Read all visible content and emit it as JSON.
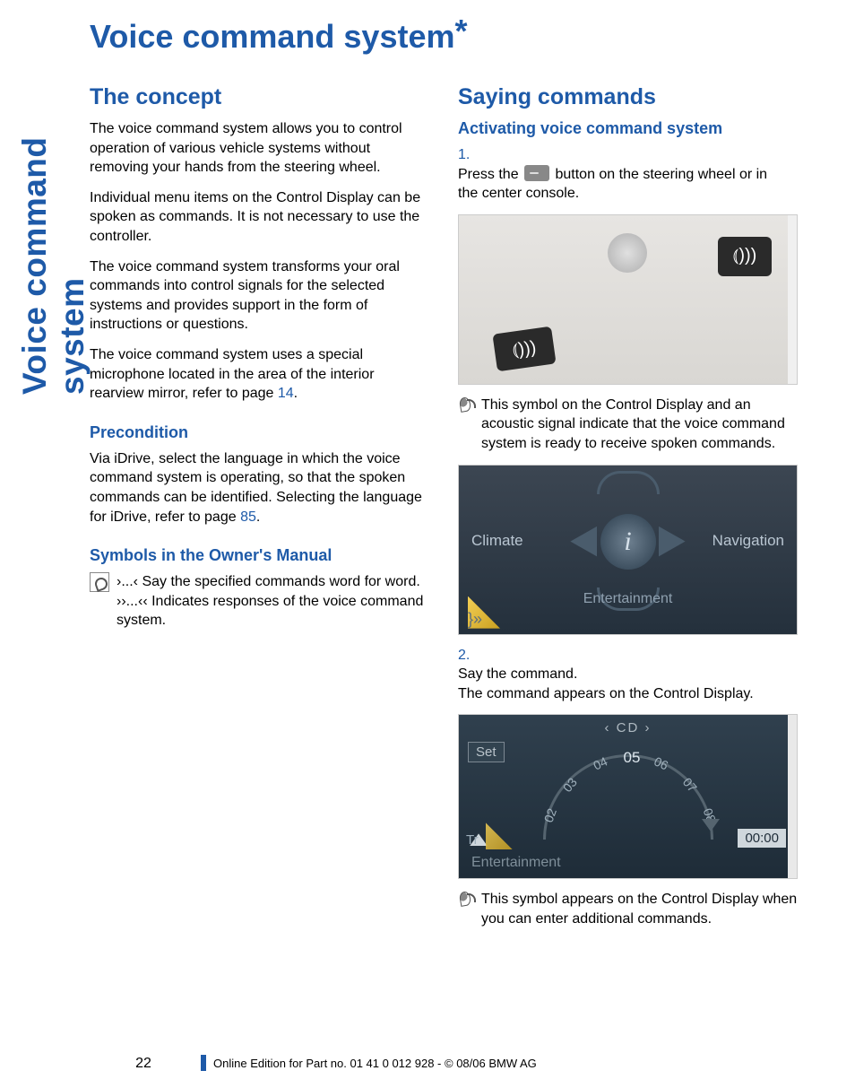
{
  "sidetab": "Voice command system",
  "title": "Voice command system",
  "title_marker": "*",
  "left": {
    "h_concept": "The concept",
    "p1": "The voice command system allows you to control operation of various vehicle systems without removing your hands from the steering wheel.",
    "p2": "Individual menu items on the Control Display can be spoken as commands. It is not necessary to use the controller.",
    "p3": "The voice command system transforms your oral commands into control signals for the selected systems and provides support in the form of instructions or questions.",
    "p4a": "The voice command system uses a special microphone located in the area of the interior rearview mirror, refer to page ",
    "p4_ref": "14",
    "p4b": ".",
    "h_precond": "Precondition",
    "p5a": "Via iDrive, select the language in which the voice command system is operating, so that the spoken commands can be identified. Selecting the language for iDrive, refer to page ",
    "p5_ref": "85",
    "p5b": ".",
    "h_symbols": "Symbols in the Owner's Manual",
    "sym1_lead": "›...‹",
    "sym1_txt": " Say the specified commands word for word.",
    "sym2_lead": "››...‹‹",
    "sym2_txt": "  Indicates responses of the voice command system."
  },
  "right": {
    "h_saying": "Saying commands",
    "h_activate": "Activating voice command system",
    "step1_num": "1.",
    "step1a": "Press the ",
    "step1b": " button on the steering wheel or in the center console.",
    "img1": {
      "btn_glyph": "⦅)))"
    },
    "p_sym1": "This symbol on the Control Display and an acoustic signal indicate that the voice command system is ready to receive spoken commands.",
    "img2": {
      "left": "Climate",
      "right": "Navigation",
      "bottom": "Entertainment",
      "center": "i"
    },
    "step2_num": "2.",
    "step2a": "Say the command.",
    "step2b": "The command appears on the Control Display.",
    "img3": {
      "top": "‹  CD  ›",
      "set": "Set",
      "ticks": [
        "02",
        "03",
        "04",
        "05",
        "06",
        "07",
        "08"
      ],
      "time": "00:00",
      "ent": "Entertainment",
      "trk": "Tr"
    },
    "p_sym2": "This symbol appears on the Control Display when you can enter additional commands."
  },
  "footer": {
    "page": "22",
    "line": "Online Edition for Part no. 01 41 0 012 928 - © 08/06 BMW AG"
  }
}
